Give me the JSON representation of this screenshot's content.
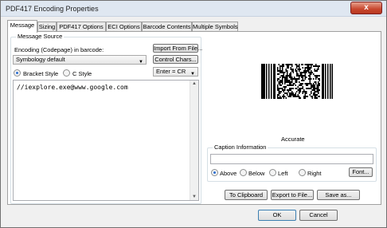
{
  "window": {
    "title": "PDF417 Encoding Properties",
    "close_symbol": "x"
  },
  "tabs": [
    "Message",
    "Sizing",
    "PDF417 Options",
    "ECI Options",
    "Barcode Contents",
    "Multiple Symbols"
  ],
  "message_source": {
    "legend": "Message Source",
    "encoding_label": "Encoding (Codepage) in barcode:",
    "encoding_value": "Symbology default",
    "import_button": "Import From File...",
    "control_chars_button": "Control Chars...",
    "enter_combo": "Enter = CR",
    "style_options": [
      "Bracket Style",
      "C Style"
    ],
    "style_selected": "Bracket Style",
    "message_text": "//iexplore.exe@www.google.com"
  },
  "preview": {
    "caption": "Accurate"
  },
  "caption_info": {
    "legend": "Caption Information",
    "value": "",
    "positions": [
      "Above",
      "Below",
      "Left",
      "Right"
    ],
    "position_selected": "Above",
    "font_button": "Font..."
  },
  "actions": {
    "clipboard": "To  Clipboard",
    "export": "Export to File...",
    "save_as": "Save as..."
  },
  "footer": {
    "ok": "OK",
    "cancel": "Cancel"
  }
}
